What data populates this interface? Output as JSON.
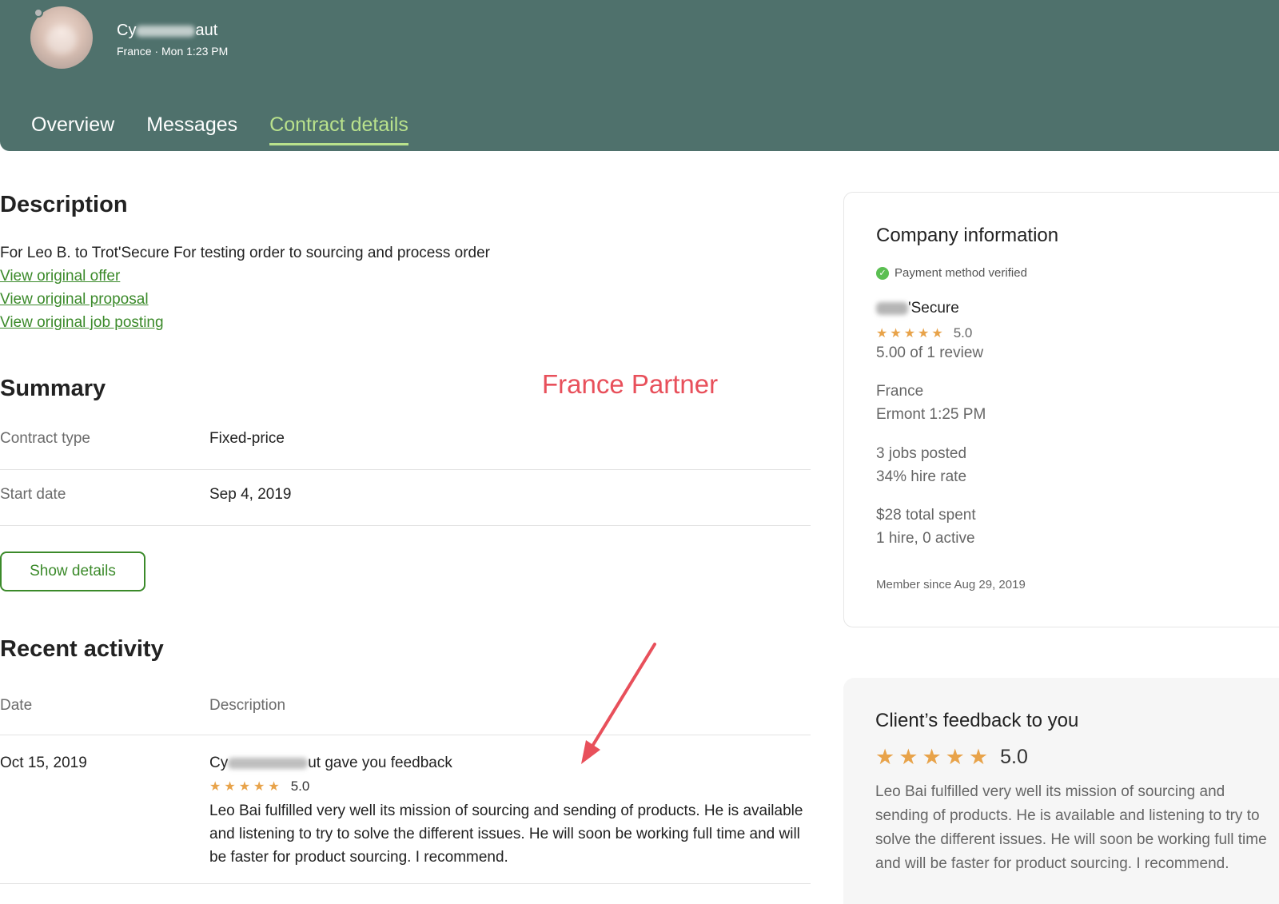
{
  "header": {
    "user_name_prefix": "Cy",
    "user_name_suffix": "aut",
    "user_meta": "France · Mon 1:23 PM",
    "tabs": [
      "Overview",
      "Messages",
      "Contract details"
    ],
    "active_tab": "Contract details"
  },
  "description": {
    "title": "Description",
    "text": "For Leo B. to Trot'Secure For testing order to sourcing and process order",
    "links": [
      "View original offer",
      "View original proposal",
      "View original job posting"
    ]
  },
  "annotation": {
    "label": "France Partner",
    "color": "#e8505b"
  },
  "summary": {
    "title": "Summary",
    "rows": [
      {
        "key": "Contract type",
        "value": "Fixed-price"
      },
      {
        "key": "Start date",
        "value": "Sep 4, 2019"
      }
    ],
    "show_details_label": "Show details"
  },
  "recent_activity": {
    "title": "Recent activity",
    "columns": [
      "Date",
      "Description"
    ],
    "rows": [
      {
        "date": "Oct 15, 2019",
        "title_prefix": "Cy",
        "title_suffix": "ut gave you feedback",
        "rating": "5.0",
        "stars": 5,
        "body": "Leo Bai fulfilled very well its mission of sourcing and sending of products. He is available and listening to try to solve the different issues. He will soon be working full time and will be faster for product sourcing. I recommend."
      }
    ]
  },
  "company": {
    "title": "Company information",
    "verified_label": "Payment method verified",
    "name_suffix": "'Secure",
    "rating": "5.0",
    "stars": 5,
    "reviews": "5.00 of 1 review",
    "country": "France",
    "city_time": "Ermont 1:25 PM",
    "jobs_posted": "3 jobs posted",
    "hire_rate": "34% hire rate",
    "total_spent": "$28 total spent",
    "hires": "1 hire, 0 active",
    "member_since": "Member since Aug 29, 2019"
  },
  "feedback": {
    "title": "Client’s feedback to you",
    "rating": "5.0",
    "stars": 5,
    "body": "Leo Bai fulfilled very well its mission of sourcing and sending of products. He is available and listening to try to solve the different issues. He will soon be working full time and will be faster for product sourcing. I recommend."
  },
  "colors": {
    "header_bg": "#4f716c",
    "tab_active": "#b9e28c",
    "link": "#3b8a2a",
    "star": "#e8a34a"
  }
}
